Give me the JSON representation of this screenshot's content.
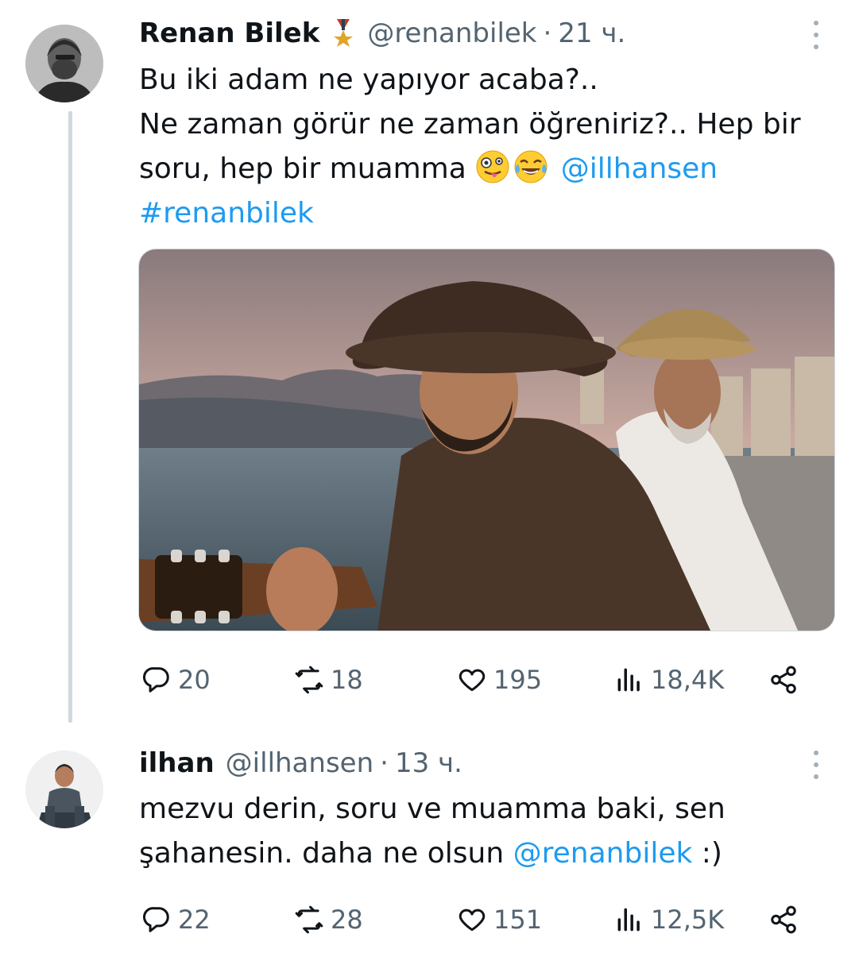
{
  "tweets": [
    {
      "name": "Renan Bilek",
      "handle": "@renanbilek",
      "separator": "·",
      "time": "21 ч.",
      "badge_icon": "medal-icon",
      "lines": [
        [
          "Bu iki adam ne yapıyor acaba?.."
        ],
        [
          "Ne zaman görür ne zaman öğreniriz?.. Hep bir"
        ],
        [
          "soru, hep bir muamma "
        ]
      ],
      "mention": "@illhansen",
      "hashtag": "#renanbilek",
      "emojis": [
        "zany-face-emoji",
        "tears-of-joy-emoji"
      ],
      "stats": {
        "replies": "20",
        "reposts": "18",
        "likes": "195",
        "views": "18,4K"
      }
    },
    {
      "name": "ilhan",
      "handle": "@illhansen",
      "separator": "·",
      "time": "13 ч.",
      "line1": "mezvu derin, soru ve muamma baki, sen",
      "line2_prefix": "şahanesin. daha ne olsun ",
      "line2_mention": "@renanbilek",
      "line2_suffix": " :)",
      "stats": {
        "replies": "22",
        "reposts": "28",
        "likes": "151",
        "views": "12,5K"
      }
    }
  ],
  "colors": {
    "link": "#1d9bf0",
    "muted": "#536471",
    "text": "#0f1419",
    "thread_line": "#cfd9de"
  }
}
